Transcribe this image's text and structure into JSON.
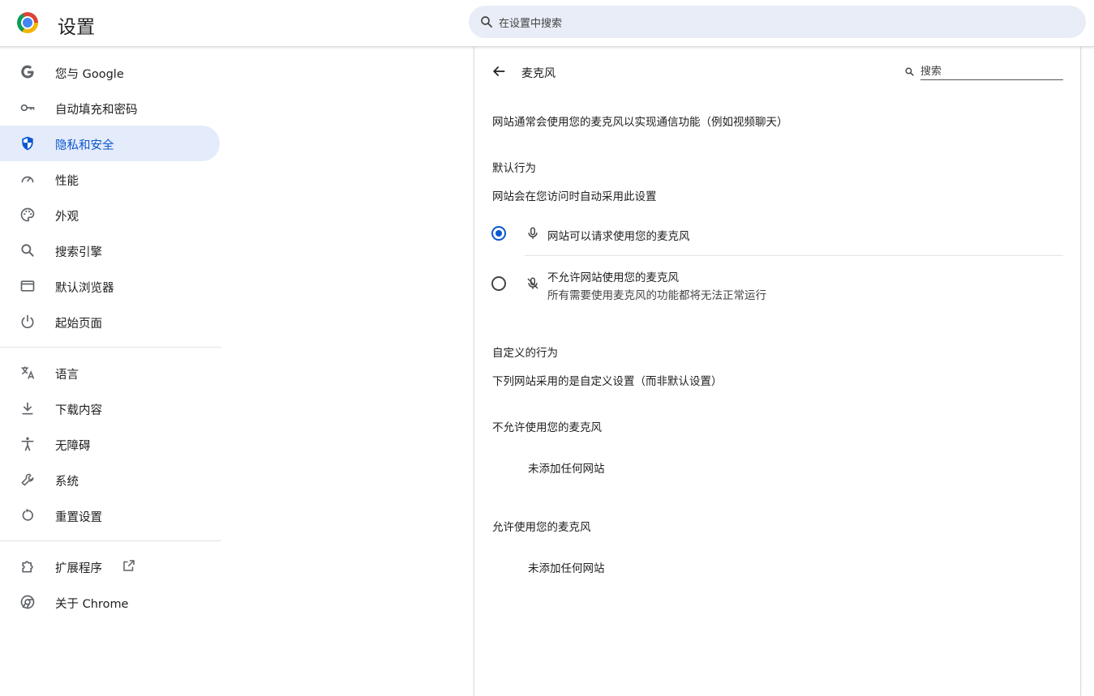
{
  "header": {
    "title": "设置",
    "search_placeholder": "在设置中搜索"
  },
  "sidebar": {
    "items": [
      {
        "label": "您与 Google",
        "icon": "google-g-icon"
      },
      {
        "label": "自动填充和密码",
        "icon": "key-icon"
      },
      {
        "label": "隐私和安全",
        "icon": "shield-icon",
        "active": true
      },
      {
        "label": "性能",
        "icon": "speedometer-icon"
      },
      {
        "label": "外观",
        "icon": "palette-icon"
      },
      {
        "label": "搜索引擎",
        "icon": "search-icon"
      },
      {
        "label": "默认浏览器",
        "icon": "browser-window-icon"
      },
      {
        "label": "起始页面",
        "icon": "power-icon"
      }
    ],
    "items2": [
      {
        "label": "语言",
        "icon": "translate-icon"
      },
      {
        "label": "下载内容",
        "icon": "download-icon"
      },
      {
        "label": "无障碍",
        "icon": "accessibility-icon"
      },
      {
        "label": "系统",
        "icon": "wrench-icon"
      },
      {
        "label": "重置设置",
        "icon": "reset-icon"
      }
    ],
    "items3": [
      {
        "label": "扩展程序",
        "icon": "puzzle-icon"
      },
      {
        "label": "关于 Chrome",
        "icon": "chrome-icon"
      }
    ]
  },
  "panel": {
    "title": "麦克风",
    "search_label": "搜索",
    "description": "网站通常会使用您的麦克风以实现通信功能（例如视频聊天）",
    "default_behavior": {
      "title": "默认行为",
      "subtitle": "网站会在您访问时自动采用此设置",
      "options": [
        {
          "label": "网站可以请求使用您的麦克风",
          "checked": true,
          "icon": "mic-icon"
        },
        {
          "label": "不允许网站使用您的麦克风",
          "sublabel": "所有需要使用麦克风的功能都将无法正常运行",
          "checked": false,
          "icon": "mic-off-icon"
        }
      ]
    },
    "custom_behavior": {
      "title": "自定义的行为",
      "subtitle": "下列网站采用的是自定义设置（而非默认设置）",
      "blocked_title": "不允许使用您的麦克风",
      "blocked_empty": "未添加任何网站",
      "allowed_title": "允许使用您的麦克风",
      "allowed_empty": "未添加任何网站"
    }
  },
  "colors": {
    "accent": "#0b57d0",
    "active_bg": "#e4ebfa",
    "search_bg": "#e8edf7"
  }
}
